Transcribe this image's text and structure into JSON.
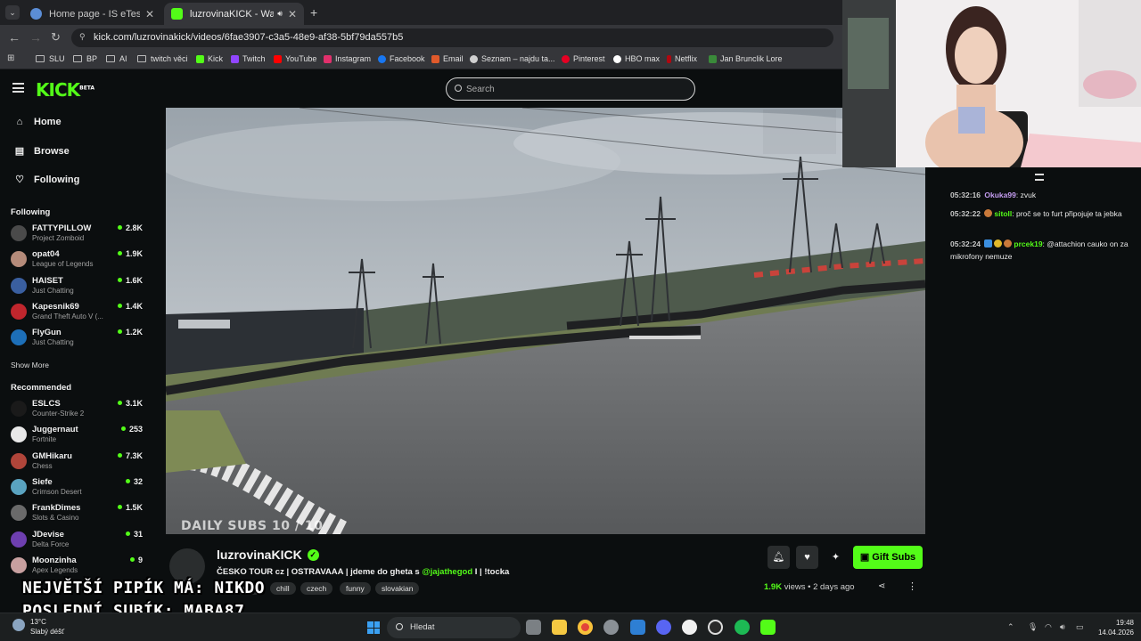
{
  "browser": {
    "tabs": [
      {
        "title": "Home page - IS eTesty",
        "active": false
      },
      {
        "title": "luzrovinaKICK - Watch the V",
        "active": true
      }
    ],
    "url": "kick.com/luzrovinakick/videos/6fae3907-c3a5-48e9-af38-5bf79da557b5",
    "bookmarks": [
      "SLU",
      "BP",
      "AI",
      "twitch věci",
      "Kick",
      "Twitch",
      "YouTube",
      "Instagram",
      "Facebook",
      "Email",
      "Seznam – najdu ta...",
      "Pinterest",
      "HBO max",
      "Netflix",
      "Jan Brunclik Lore"
    ]
  },
  "kick": {
    "logo": "KICK",
    "logo_badge": "BETA",
    "search_placeholder": "Search",
    "nav": [
      {
        "label": "Home",
        "icon": "home-icon"
      },
      {
        "label": "Browse",
        "icon": "browse-icon"
      },
      {
        "label": "Following",
        "icon": "heart-icon"
      }
    ],
    "following_title": "Following",
    "following": [
      {
        "name": "FATTYPILLOW",
        "category": "Project Zomboid",
        "viewers": "2.8K",
        "color": "#4a4a4a"
      },
      {
        "name": "opat04",
        "category": "League of Legends",
        "viewers": "1.9K",
        "color": "#b58b7a"
      },
      {
        "name": "HAISET",
        "category": "Just Chatting",
        "viewers": "1.6K",
        "color": "#3a5fa0"
      },
      {
        "name": "Kapesnik69",
        "category": "Grand Theft Auto V (...",
        "viewers": "1.4K",
        "color": "#c0262d"
      },
      {
        "name": "FlyGun",
        "category": "Just Chatting",
        "viewers": "1.2K",
        "color": "#1d6fb8"
      }
    ],
    "show_more": "Show More",
    "recommended_title": "Recommended",
    "recommended": [
      {
        "name": "ESLCS",
        "category": "Counter-Strike 2",
        "viewers": "3.1K",
        "color": "#1a1a1a"
      },
      {
        "name": "Juggernaut",
        "category": "Fortnite",
        "viewers": "253",
        "color": "#e8e8e8"
      },
      {
        "name": "GMHikaru",
        "category": "Chess",
        "viewers": "7.3K",
        "color": "#b0453a"
      },
      {
        "name": "Siefe",
        "category": "Crimson Desert",
        "viewers": "32",
        "color": "#5aa3c0"
      },
      {
        "name": "FrankDimes",
        "category": "Slots & Casino",
        "viewers": "1.5K",
        "color": "#6a6a6a"
      },
      {
        "name": "JDevise",
        "category": "Delta Force",
        "viewers": "31",
        "color": "#6e3fb0"
      },
      {
        "name": "Moonzinha",
        "category": "Apex Legends",
        "viewers": "9",
        "color": "#c8a0a0"
      }
    ]
  },
  "video": {
    "overlay_text": "DAILY SUBS 10 / 10"
  },
  "stream": {
    "streamer": "luzrovinaKICK",
    "title_prefix": "ČESKO TOUR cz | OSTRAVAAA | jdeme do gheta s ",
    "title_mention": "@jajathegod",
    "title_suffix": " I  | !tocka",
    "tags": [
      "chill",
      "czech",
      "funny",
      "slovakian"
    ],
    "partial_tag": "ech",
    "views": "1.9K",
    "views_label": "views",
    "age": "2 days ago",
    "gift_button": "Gift Subs"
  },
  "chat": {
    "messages": [
      {
        "time": "05:32:16",
        "user": "Okuka99",
        "user_color": "#c49cf0",
        "text": "zvuk"
      },
      {
        "time": "05:32:22",
        "user": "sitoll",
        "user_color": "#53fc18",
        "text": "proč se to furt připojuje ta jebka"
      },
      {
        "time": "05:32:24",
        "user": "prcek19",
        "user_color": "#53fc18",
        "text": "@attachion cauko on za mikrofony nemuze"
      }
    ]
  },
  "stream_overlay": {
    "line1": "NEJVĚTŠÍ PIPÍK MÁ: NIKDO",
    "line2": "POSLEDNÍ SUBÍK: MABA87"
  },
  "taskbar": {
    "weather_temp": "13°C",
    "weather_desc": "Slabý déšť",
    "search_placeholder": "Hledat",
    "time": "19:48",
    "date": "14.04.2026"
  }
}
